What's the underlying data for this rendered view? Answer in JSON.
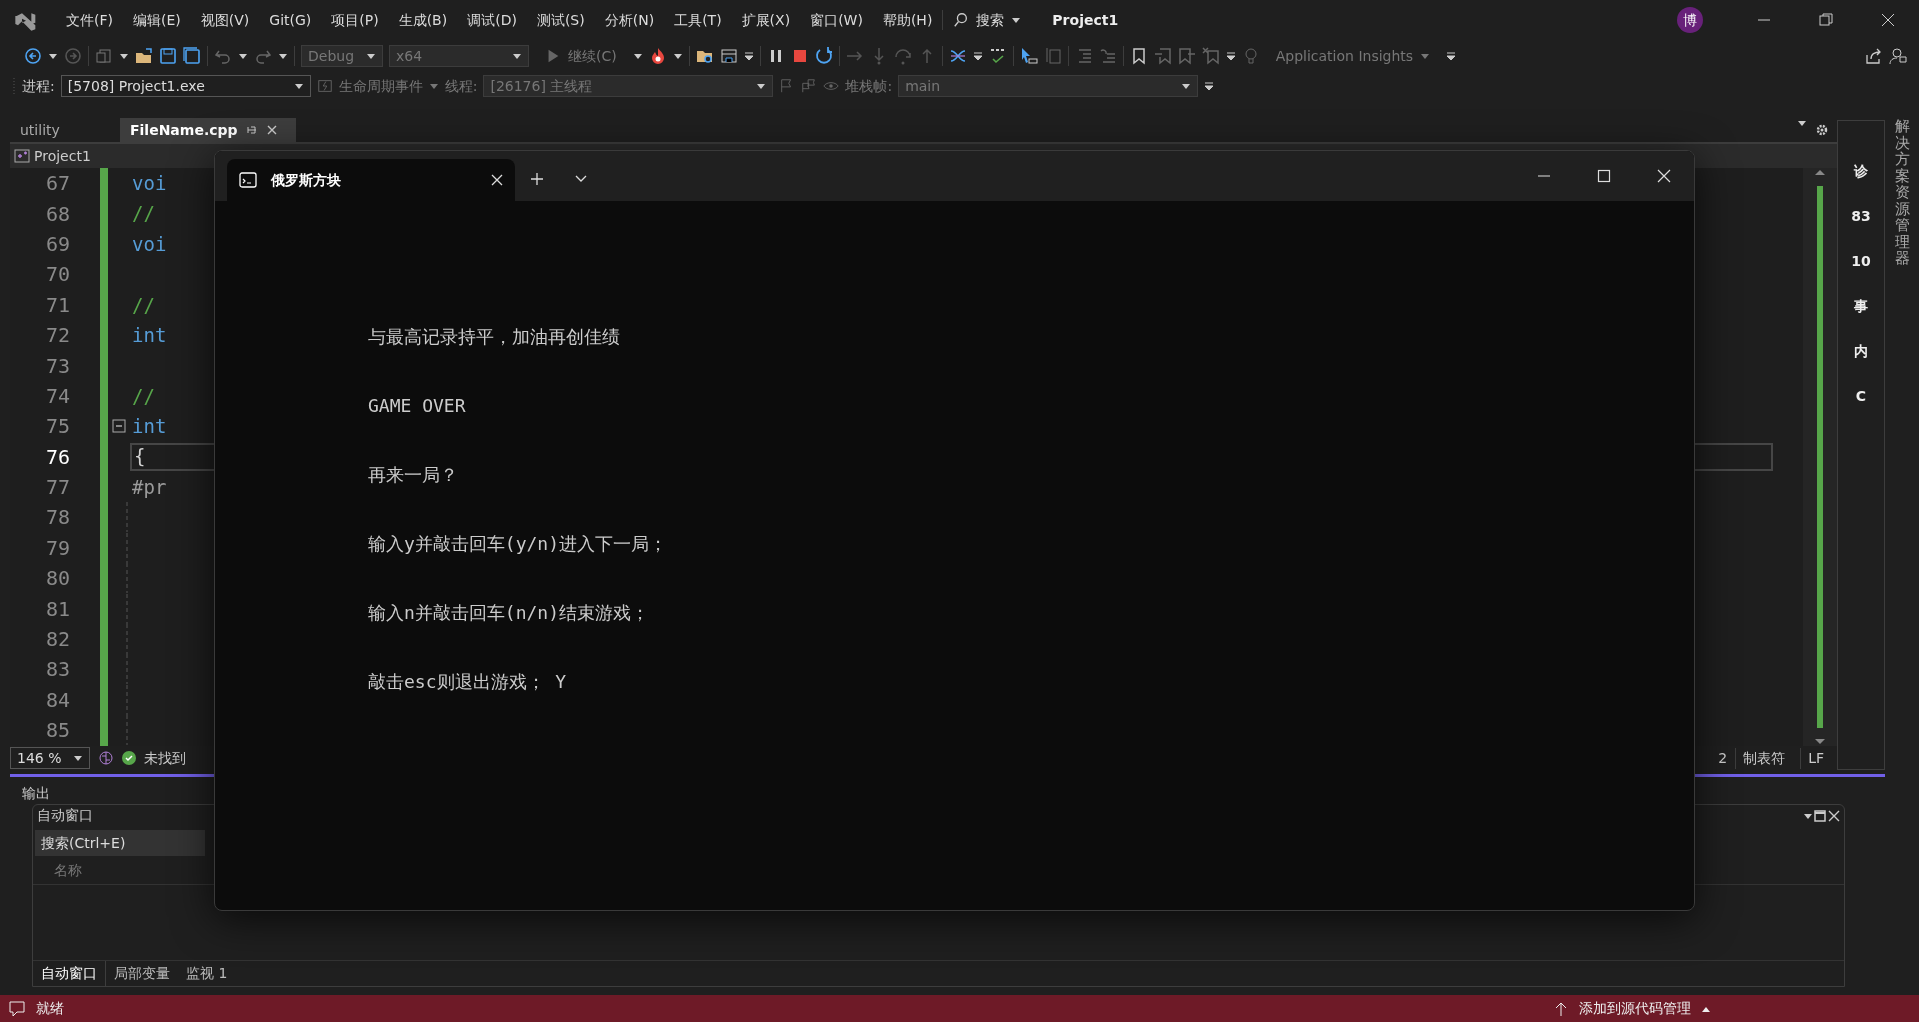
{
  "title_bar": {
    "menus": [
      "文件(F)",
      "编辑(E)",
      "视图(V)",
      "Git(G)",
      "项目(P)",
      "生成(B)",
      "调试(D)",
      "测试(S)",
      "分析(N)",
      "工具(T)",
      "扩展(X)",
      "窗口(W)",
      "帮助(H)"
    ],
    "search": "搜索",
    "solution": "Project1",
    "avatar": "博"
  },
  "toolbar": {
    "configuration": "Debug",
    "platform": "x64",
    "continue": "继续(C)",
    "insights": "Application Insights"
  },
  "debug_location": {
    "process_label": "进程:",
    "process": "[5708] Project1.exe",
    "lifecycle": "生命周期事件",
    "thread_label": "线程:",
    "thread": "[26176] 主线程",
    "frame_label": "堆栈帧:",
    "frame": "main"
  },
  "doc_tabs": [
    {
      "label": "utility",
      "selected": false
    },
    {
      "label": "FileName.cpp",
      "selected": true
    }
  ],
  "nav_bar": {
    "project": "Project1"
  },
  "editor": {
    "lines": [
      {
        "number": "67",
        "current": false,
        "fold": false,
        "kind": "keyword",
        "text": "voi"
      },
      {
        "number": "68",
        "current": false,
        "fold": false,
        "kind": "comment",
        "text": "//"
      },
      {
        "number": "69",
        "current": false,
        "fold": false,
        "kind": "keyword",
        "text": "voi"
      },
      {
        "number": "70",
        "current": false,
        "fold": false
      },
      {
        "number": "71",
        "current": false,
        "fold": false,
        "kind": "comment",
        "text": "//"
      },
      {
        "number": "72",
        "current": false,
        "fold": false,
        "kind": "keyword",
        "text": "int"
      },
      {
        "number": "73",
        "current": false,
        "fold": false
      },
      {
        "number": "74",
        "current": false,
        "fold": false,
        "kind": "comment",
        "text": "//"
      },
      {
        "number": "75",
        "current": false,
        "fold": true,
        "kind": "keyword",
        "text": "int"
      },
      {
        "number": "76",
        "current": true,
        "fold": false,
        "kind": "plain",
        "text": "{"
      },
      {
        "number": "77",
        "current": false,
        "fold": false,
        "kind": "preprocessor",
        "text": "#pr"
      },
      {
        "number": "78",
        "current": false,
        "fold": false
      },
      {
        "number": "79",
        "current": false,
        "fold": false
      },
      {
        "number": "80",
        "current": false,
        "fold": false
      },
      {
        "number": "81",
        "current": false,
        "fold": false
      },
      {
        "number": "82",
        "current": false,
        "fold": false
      },
      {
        "number": "83",
        "current": false,
        "fold": false
      },
      {
        "number": "84",
        "current": false,
        "fold": false
      },
      {
        "number": "85",
        "current": false,
        "fold": false
      }
    ],
    "zoom": "146 %",
    "issues": "未找到",
    "column": "2",
    "indent": "制表符",
    "line_ending": "LF"
  },
  "tool_panel": {
    "items": [
      "诊",
      "83",
      "10",
      "事",
      "内",
      "C"
    ]
  },
  "side_tab": "解决方案资源管理器",
  "output_panel": {
    "title": "输出"
  },
  "autos_window": {
    "title": "自动窗口",
    "search": {
      "placeholder": "搜索(Ctrl+E)"
    },
    "columns": [
      "名称"
    ],
    "tabs": [
      {
        "label": "自动窗口",
        "selected": true
      },
      {
        "label": "局部变量",
        "selected": false
      },
      {
        "label": "监视 1",
        "selected": false
      }
    ]
  },
  "status_bar": {
    "state": "就绪",
    "source_control": "添加到源代码管理"
  },
  "terminal": {
    "tab_title": "俄罗斯方块",
    "lines": [
      "与最高记录持平，加油再创佳绩",
      "GAME OVER",
      "再来一局？",
      "输入y并敲击回车(y/n)进入下一局；",
      "输入n并敲击回车(n/n)结束游戏；",
      "敲击esc则退出游戏； Y"
    ]
  }
}
